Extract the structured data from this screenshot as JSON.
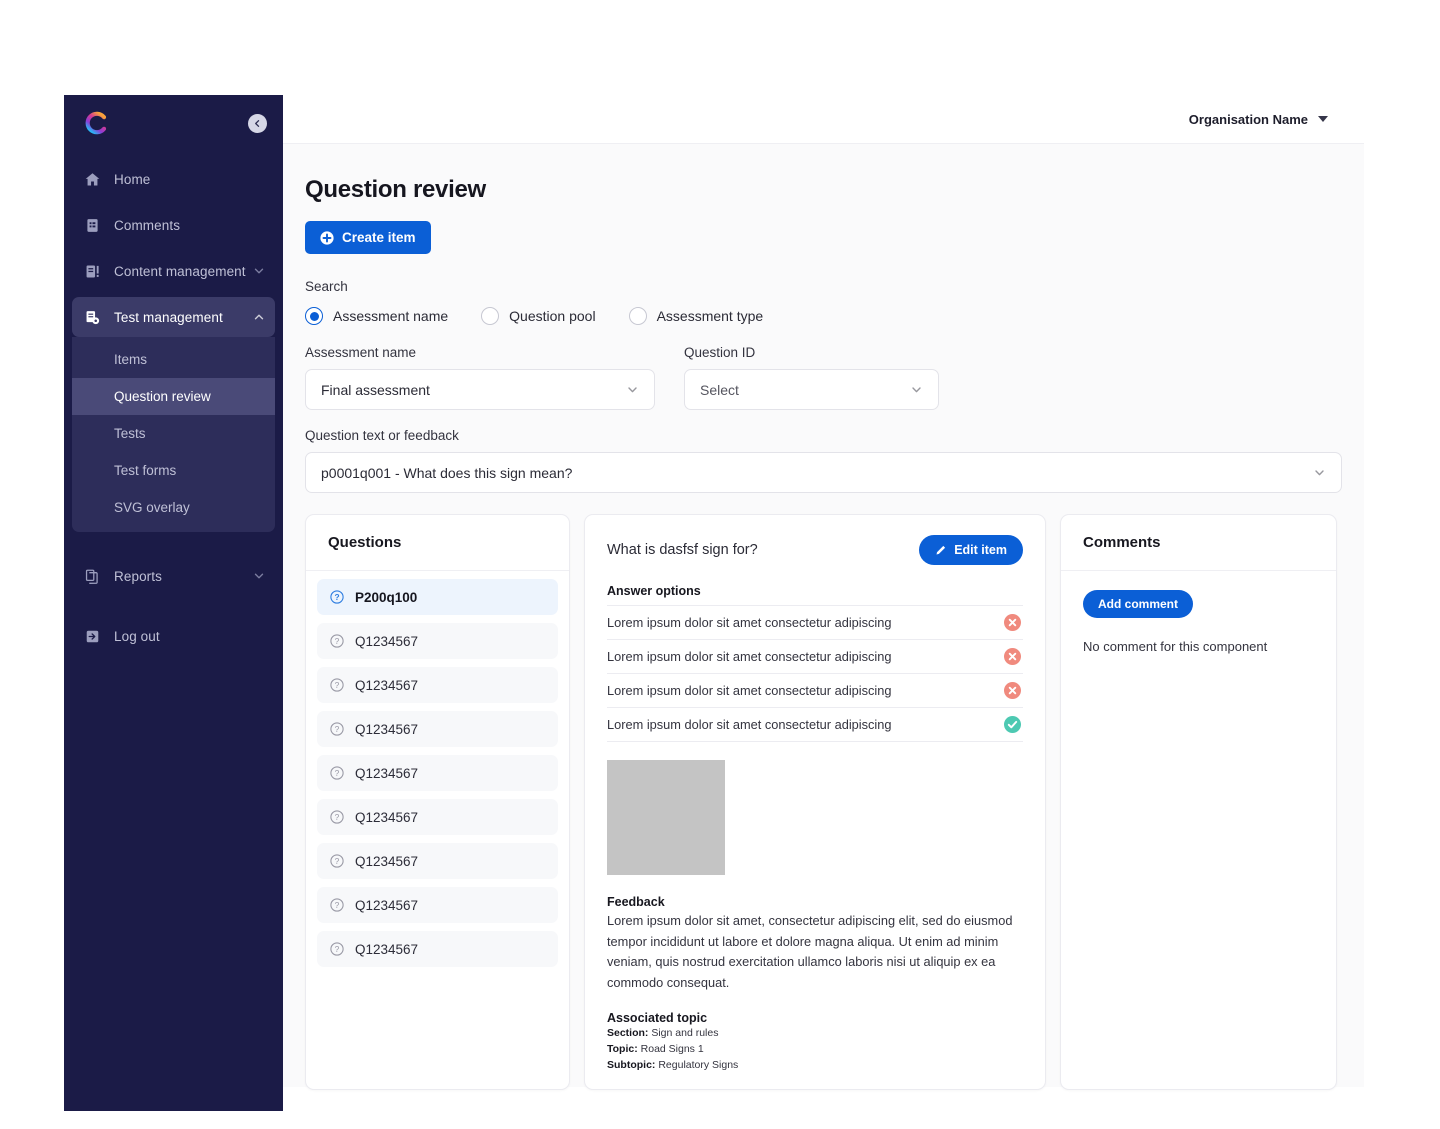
{
  "brand": {
    "accent": "#0B5FD6",
    "sidebar_bg": "#1B1B47",
    "logo_name": "brand-logo"
  },
  "sidebar": {
    "collapse_label": "collapse-sidebar",
    "items": [
      {
        "label": "Home",
        "icon": "home-icon",
        "expandable": false
      },
      {
        "label": "Comments",
        "icon": "comments-icon",
        "expandable": false
      },
      {
        "label": "Content management",
        "icon": "content-management-icon",
        "expandable": true,
        "expanded": false
      },
      {
        "label": "Test management",
        "icon": "test-management-icon",
        "expandable": true,
        "expanded": true,
        "active": true
      }
    ],
    "submenu": [
      {
        "label": "Items",
        "active": false
      },
      {
        "label": "Question review",
        "active": true
      },
      {
        "label": "Tests",
        "active": false
      },
      {
        "label": "Test forms",
        "active": false
      },
      {
        "label": "SVG overlay",
        "active": false
      }
    ],
    "bottom_items": [
      {
        "label": "Reports",
        "icon": "reports-icon",
        "expandable": true
      },
      {
        "label": "Log out",
        "icon": "logout-icon",
        "expandable": false
      }
    ]
  },
  "topbar": {
    "org_name": "Organisation Name"
  },
  "page": {
    "title": "Question review",
    "create_button": "Create item",
    "search_label": "Search",
    "radio_options": [
      {
        "label": "Assessment name",
        "checked": true
      },
      {
        "label": "Question pool",
        "checked": false
      },
      {
        "label": "Assessment type",
        "checked": false
      }
    ],
    "fields": {
      "assessment_name_label": "Assessment  name",
      "assessment_name_value": "Final assessment",
      "question_id_label": "Question ID",
      "question_id_value": "Select",
      "question_text_label": "Question text or feedback",
      "question_text_value": "p0001q001 - What does this sign mean?"
    }
  },
  "questions_panel": {
    "title": "Questions",
    "items": [
      {
        "id": "P200q100",
        "selected": true
      },
      {
        "id": "Q1234567",
        "selected": false
      },
      {
        "id": "Q1234567",
        "selected": false
      },
      {
        "id": "Q1234567",
        "selected": false
      },
      {
        "id": "Q1234567",
        "selected": false
      },
      {
        "id": "Q1234567",
        "selected": false
      },
      {
        "id": "Q1234567",
        "selected": false
      },
      {
        "id": "Q1234567",
        "selected": false
      },
      {
        "id": "Q1234567",
        "selected": false
      }
    ]
  },
  "detail_panel": {
    "question_text": "What is dasfsf sign for?",
    "edit_button": "Edit item",
    "answer_options_title": "Answer options",
    "answers": [
      {
        "text": "Lorem ipsum dolor sit amet consectetur adipiscing",
        "correct": false
      },
      {
        "text": "Lorem ipsum dolor sit amet consectetur adipiscing",
        "correct": false
      },
      {
        "text": "Lorem ipsum dolor sit amet consectetur adipiscing",
        "correct": false
      },
      {
        "text": "Lorem ipsum dolor sit amet consectetur adipiscing",
        "correct": true
      }
    ],
    "feedback_title": "Feedback",
    "feedback_text": "Lorem ipsum dolor sit amet, consectetur adipiscing elit, sed do eiusmod tempor incididunt ut labore et dolore magna aliqua. Ut enim ad minim veniam, quis nostrud exercitation ullamco laboris nisi ut aliquip ex ea commodo consequat.",
    "topic_title": "Associated topic",
    "topic": {
      "section_label": "Section:",
      "section_value": "Sign and rules",
      "topic_label": "Topic:",
      "topic_value": "Road Signs 1",
      "subtopic_label": "Subtopic:",
      "subtopic_value": "Regulatory Signs"
    }
  },
  "comments_panel": {
    "title": "Comments",
    "add_button": "Add comment",
    "empty_text": "No comment for this component"
  },
  "status_colors": {
    "incorrect": "#F08A7E",
    "correct": "#4DC9B2"
  }
}
